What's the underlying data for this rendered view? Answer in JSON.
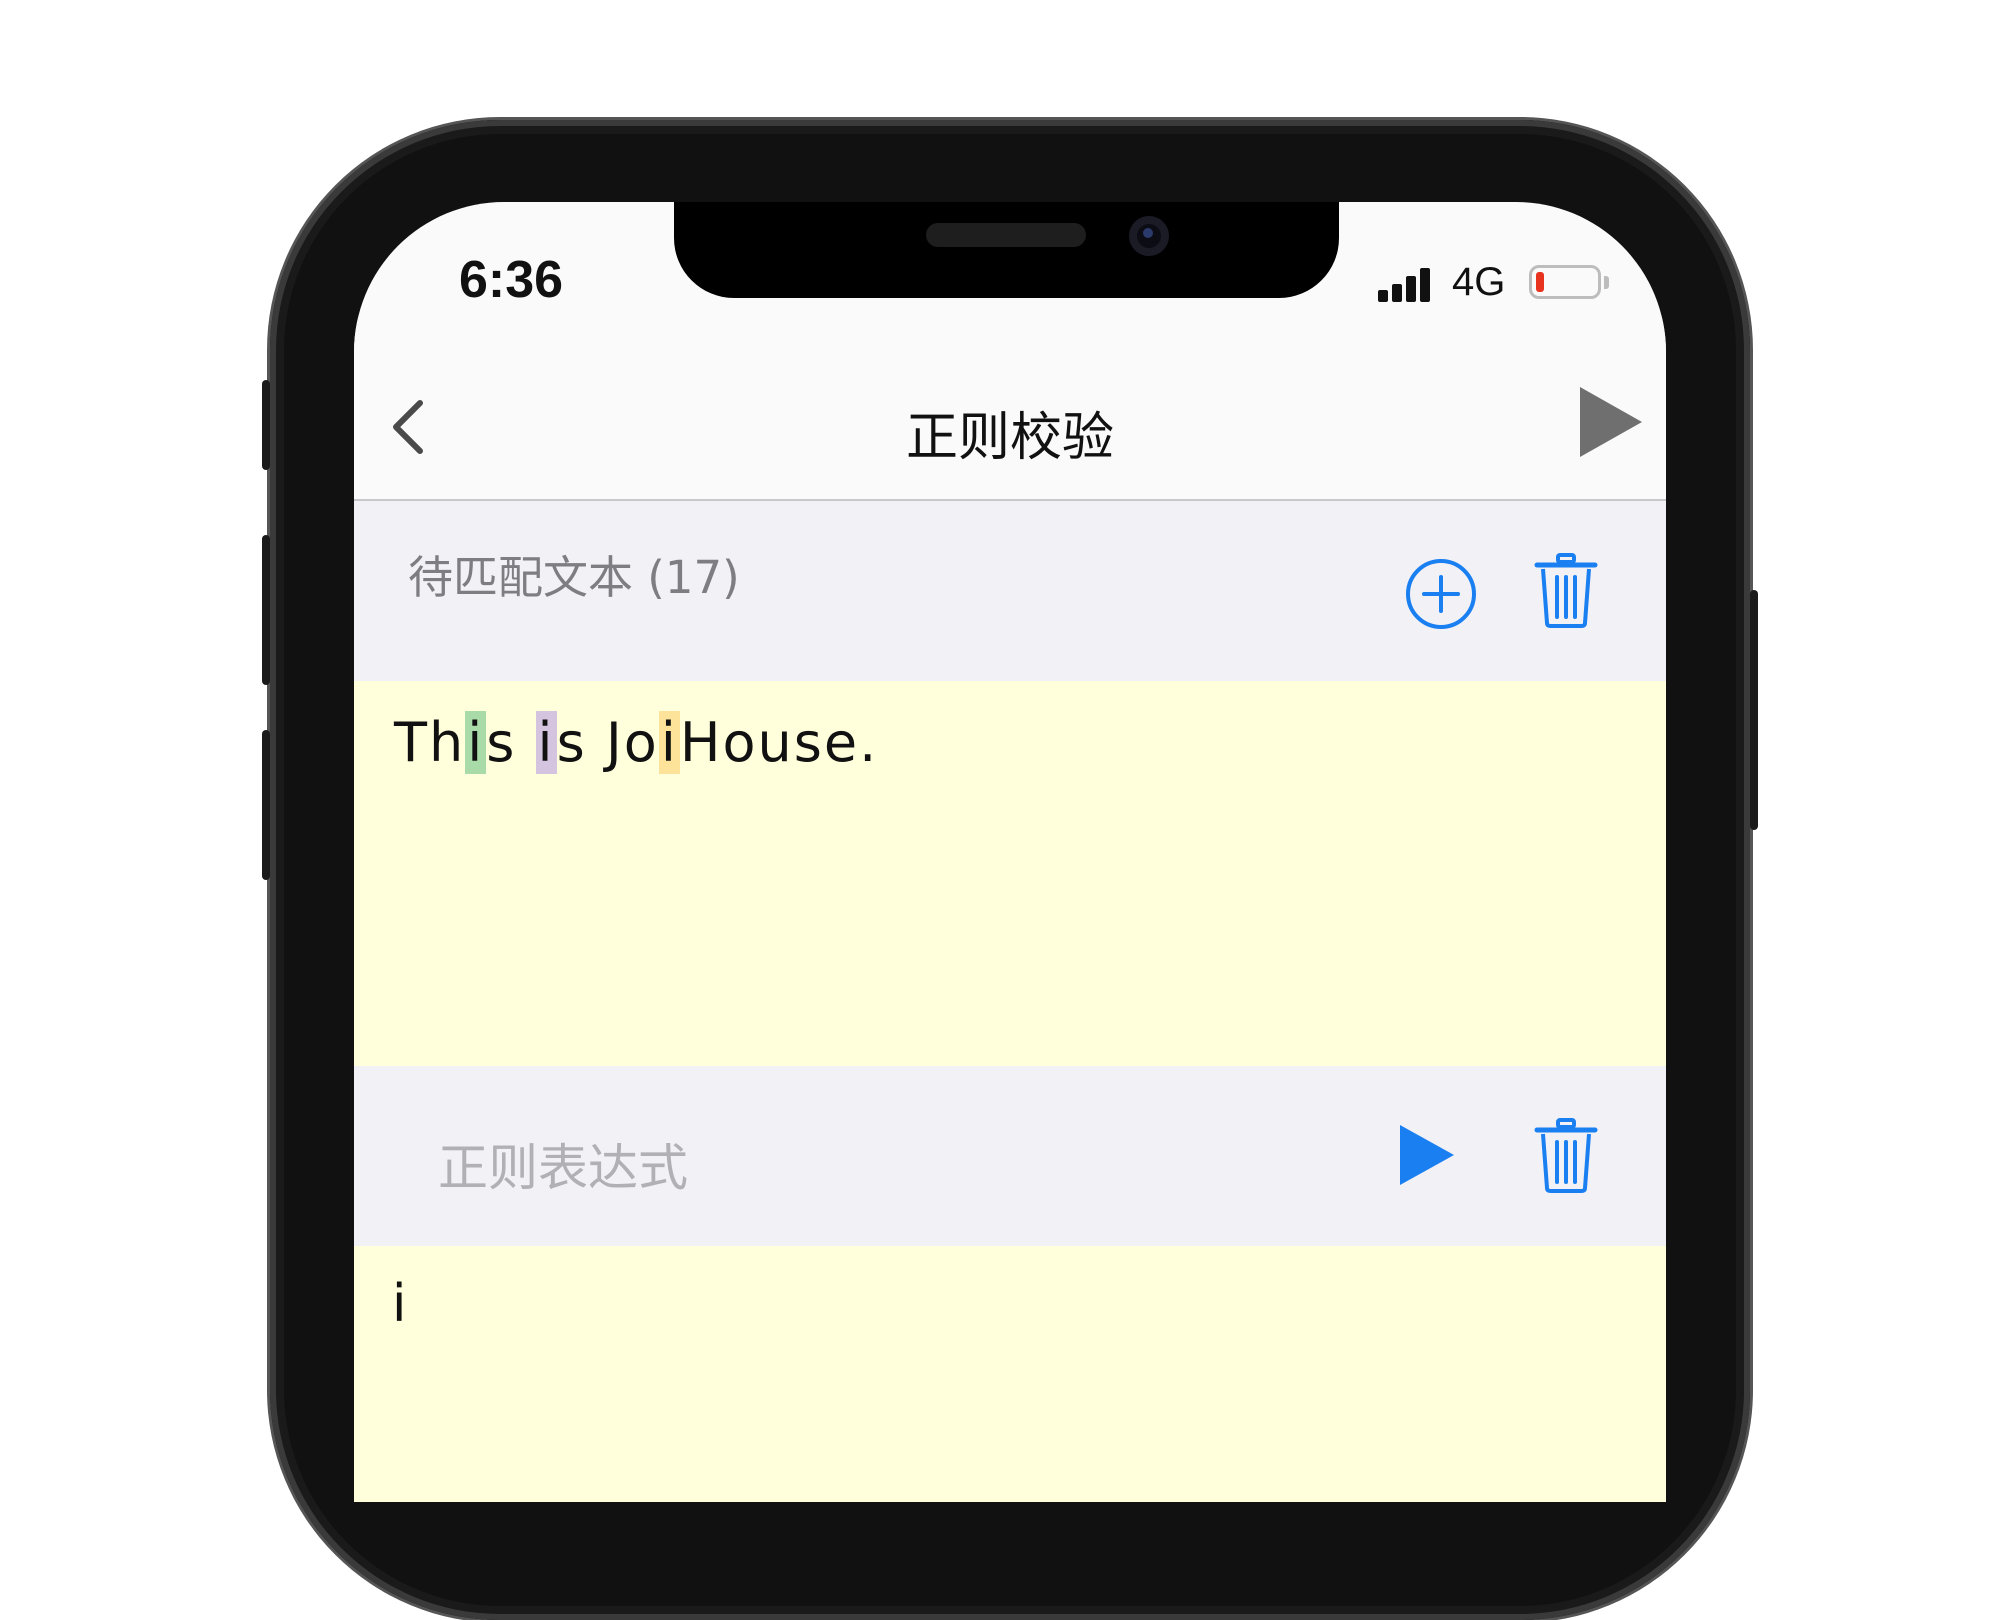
{
  "status_bar": {
    "time": "6:36",
    "network": "4G",
    "signal_icon": "cellular-signal-icon",
    "battery_icon": "battery-low-icon",
    "battery_level_percent": 8
  },
  "nav": {
    "title": "正则校验",
    "back_icon": "chevron-left-icon",
    "run_icon": "play-icon"
  },
  "text_section": {
    "label": "待匹配文本 (17)",
    "add_icon": "plus-circle-icon",
    "delete_icon": "trash-icon",
    "content_segments": [
      {
        "text": "Th",
        "highlight": null
      },
      {
        "text": "i",
        "highlight": "#a8dba8"
      },
      {
        "text": "s ",
        "highlight": null
      },
      {
        "text": "i",
        "highlight": "#d5c4df"
      },
      {
        "text": "s Jo",
        "highlight": null
      },
      {
        "text": "i",
        "highlight": "#fde39a"
      },
      {
        "text": "House.",
        "highlight": null
      }
    ]
  },
  "regex_section": {
    "placeholder": "正则表达式",
    "run_icon": "play-icon",
    "delete_icon": "trash-icon",
    "value": "i"
  },
  "colors": {
    "accent": "#1a7ff0",
    "input_bg": "#ffffdc",
    "section_bg": "#f1f1f6"
  }
}
